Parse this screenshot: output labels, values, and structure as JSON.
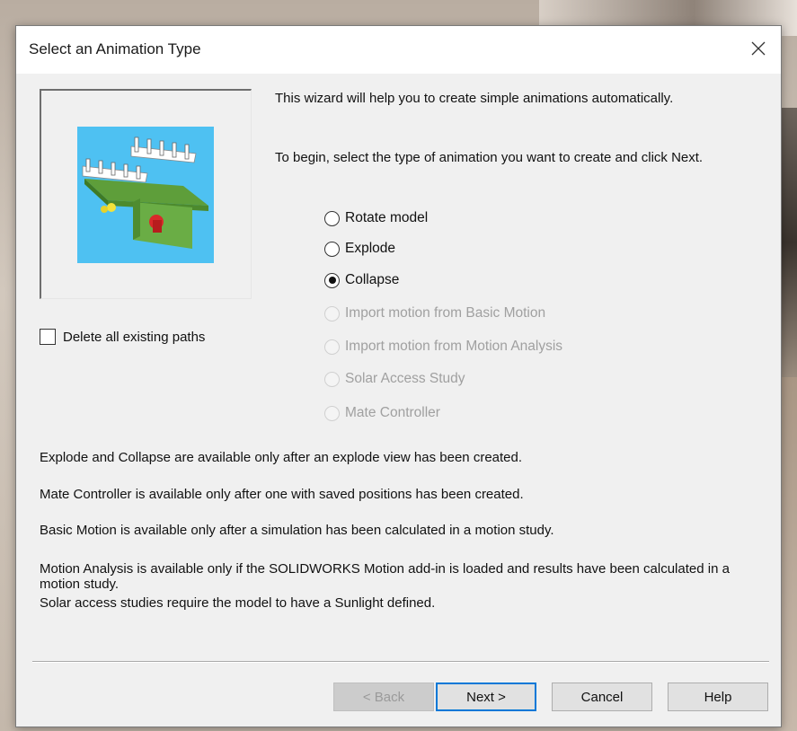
{
  "dialog": {
    "title": "Select an Animation Type",
    "close_icon": "close-icon"
  },
  "intro": {
    "line1": "This wizard will help you to create simple animations automatically.",
    "line2": "To begin, select the type of animation you want to create and click Next."
  },
  "preview": {
    "icon": "assembly-model-preview",
    "background_color": "#4ec1f2"
  },
  "checkbox": {
    "label": "Delete all existing paths",
    "checked": false
  },
  "options": [
    {
      "label": "Rotate model",
      "checked": false,
      "enabled": true
    },
    {
      "label": "Explode",
      "checked": false,
      "enabled": true
    },
    {
      "label": "Collapse",
      "checked": true,
      "enabled": true
    },
    {
      "label": "Import motion from Basic Motion",
      "checked": false,
      "enabled": false
    },
    {
      "label": "Import motion from Motion Analysis",
      "checked": false,
      "enabled": false
    },
    {
      "label": "Solar Access Study",
      "checked": false,
      "enabled": false
    },
    {
      "label": "Mate Controller",
      "checked": false,
      "enabled": false
    }
  ],
  "notes": {
    "explode": "Explode and Collapse are available only after an explode view has been created.",
    "mate": "Mate Controller is available only after one with saved positions has been created.",
    "basic": "Basic Motion is available only after a simulation has been calculated in a motion study.",
    "motion": "Motion Analysis is available only if the SOLIDWORKS Motion add-in is loaded and results have been calculated in a motion study.",
    "solar": "Solar access studies require the model to have a Sunlight defined."
  },
  "buttons": {
    "back": "< Back",
    "next": "Next >",
    "cancel": "Cancel",
    "help": "Help"
  },
  "colors": {
    "accent": "#0078d7"
  }
}
